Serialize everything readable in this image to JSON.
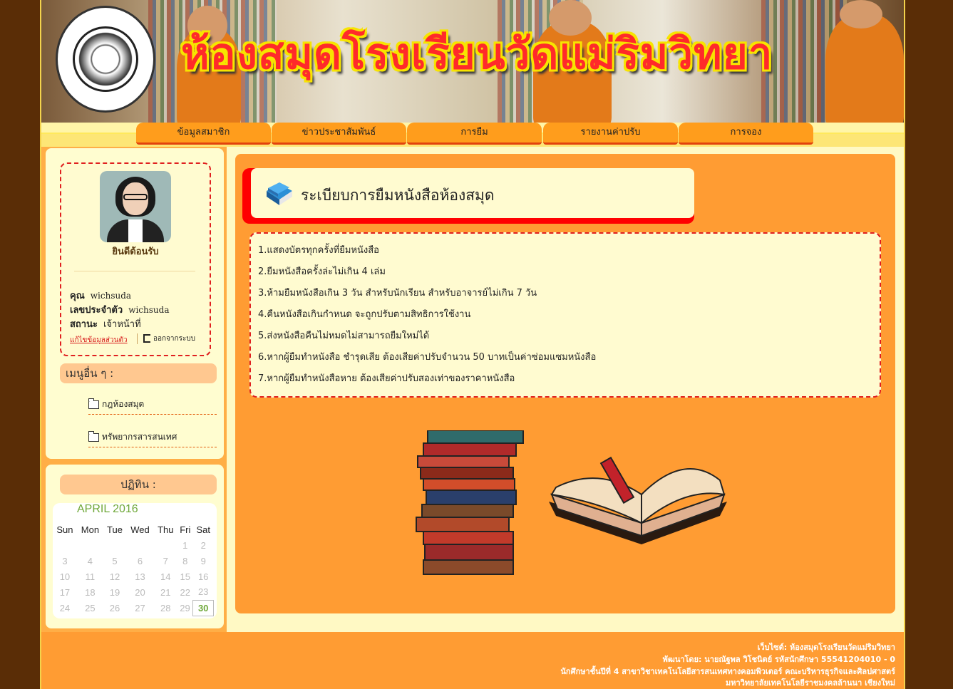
{
  "header": {
    "site_title": "ห้องสมุดโรงเรียนวัดแม่ริมวิทยา"
  },
  "nav": {
    "items": [
      "ข้อมูลสมาชิก",
      "ข่าวประชาสัมพันธ์",
      "การยืม",
      "รายงานค่าปรับ",
      "การจอง"
    ]
  },
  "profile": {
    "welcome": "ยินดีต้อนรับ",
    "name_label": "คุณ",
    "name_value": "wichsuda",
    "id_label": "เลขประจำตัว",
    "id_value": "wichsuda",
    "status_label": "สถานะ",
    "status_value": "เจ้าหน้าที่",
    "edit_link": "แก้ไขข้อมูลส่วนตัว",
    "logout_link": "ออกจากระบบ"
  },
  "other_menu": {
    "heading": "เมนูอื่น ๆ :",
    "items": [
      "กฎห้องสมุด",
      "ทรัพยากรสารสนเทศ"
    ]
  },
  "calendar": {
    "heading": "ปฏิทิน :",
    "month": "APRIL 2016",
    "weekdays": [
      "Sun",
      "Mon",
      "Tue",
      "Wed",
      "Thu",
      "Fri",
      "Sat"
    ],
    "today": "30",
    "weeks": [
      [
        "",
        "",
        "",
        "",
        "",
        "1",
        "2"
      ],
      [
        "3",
        "4",
        "5",
        "6",
        "7",
        "8",
        "9"
      ],
      [
        "10",
        "11",
        "12",
        "13",
        "14",
        "15",
        "16"
      ],
      [
        "17",
        "18",
        "19",
        "20",
        "21",
        "22",
        "23"
      ],
      [
        "24",
        "25",
        "26",
        "27",
        "28",
        "29",
        "30"
      ]
    ]
  },
  "main": {
    "title": "ระเบียบการยืมหนังสือห้องสมุด",
    "rules": [
      "1.แสดงบัตรทุกครั้งที่ยืมหนังสือ",
      "2.ยืมหนังสือครั้งล่ะไม่เกิน 4 เล่ม",
      "3.ห้ามยืมหนังสือเกิน 3 วัน สำหรับนักเรียน สำหรับอาจารย์ไม่เกิน 7 วัน",
      "4.คืนหนังสือเกินกำหนด จะถูกปรับตามสิทธิการใช้งาน",
      "5.ส่งหนังสือคืนไม่หมดไม่สามารถยืมใหม่ได้",
      "6.หากผู้ยืมทำหนังสือ ชำรุดเสีย ต้องเสียค่าปรับจำนวน 50 บาทเป็นค่าซ่อมแซมหนังสือ",
      "7.หากผู้ยืมทำหนังสือหาย ต้องเสียค่าปรับสองเท่าของราคาหนังสือ"
    ]
  },
  "footer": {
    "lines": [
      "เว็บไซต์: ห้องสมุดโรงเรียนวัดแม่ริมวิทยา",
      "พัฒนาโดย: นายณัฐพล วิโชนิตย์ รหัสนักศึกษา 55541204010 - 0",
      "นักศึกษาชั้นปีที่ 4 สาขาวิชาเทคโนโลยีสารสนเทศทางคอมพิวเตอร์ คณะบริหารธุรกิจและศิลปศาสตร์",
      "มหาวิทยาลัยเทคโนโลยีราชมงคลล้านนา เชียงใหม่"
    ]
  },
  "colors": {
    "page_bg": "#5a2d06",
    "accent_orange": "#ff9c33",
    "cream": "#fffbd0",
    "red": "#ff0000",
    "calendar_green": "#6fa83a"
  }
}
